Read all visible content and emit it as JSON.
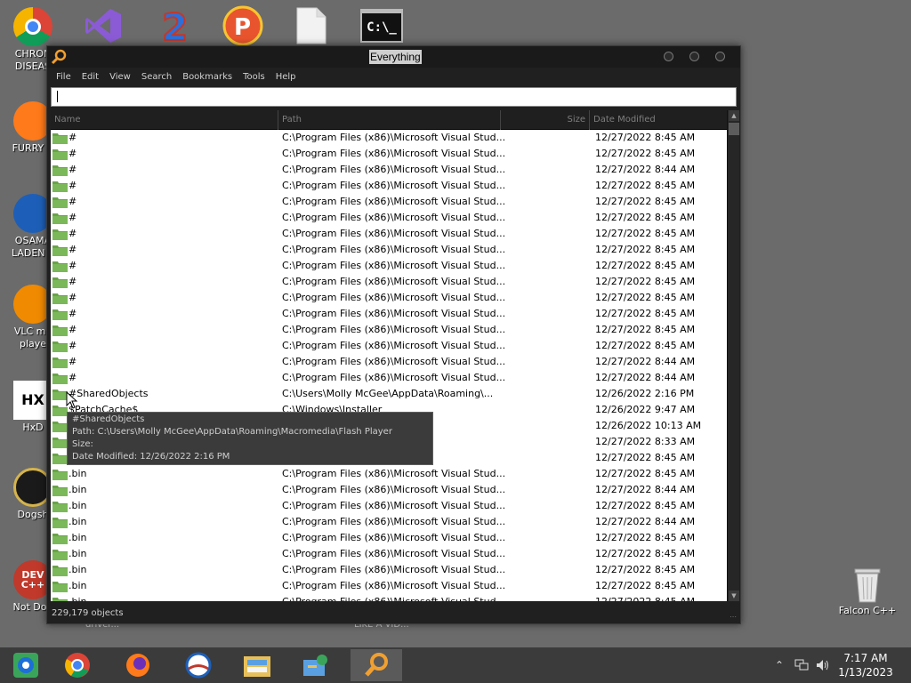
{
  "desktop": {
    "left_icons": [
      {
        "label": "CHRON\nDISEAS",
        "icon": "chrome-icon"
      },
      {
        "label": "FURRY C",
        "icon": "firefox-icon"
      },
      {
        "label": "OSAMA\nLADEN E",
        "icon": "obama-logo-icon"
      },
      {
        "label": "VLC me\nplaye",
        "icon": "vlc-icon"
      },
      {
        "label": "HxD",
        "icon": "hxd-icon"
      },
      {
        "label": "Dogsh",
        "icon": "disc-icon"
      },
      {
        "label": "Not Dog",
        "icon": "devcpp-icon"
      }
    ],
    "left_glyphs": [
      "",
      "",
      "",
      "",
      "HX",
      "",
      "DEV\nC++"
    ],
    "top_icons": [
      {
        "icon": "visual-studio-icon"
      },
      {
        "icon": "number-2-icon"
      },
      {
        "icon": "p-logo-icon"
      },
      {
        "icon": "blank-file-icon"
      },
      {
        "icon": "cmd-icon"
      }
    ],
    "cmd_glyph": "C:\\_",
    "right_icon": {
      "label": "Falcon C++",
      "icon": "recycle-bin-icon"
    },
    "behind_text": [
      "driver...",
      "LIKE A VID..."
    ]
  },
  "window": {
    "title": "Everything",
    "menu": [
      "File",
      "Edit",
      "View",
      "Search",
      "Bookmarks",
      "Tools",
      "Help"
    ],
    "search_value": "",
    "columns": [
      "Name",
      "Path",
      "Size",
      "Date Modified"
    ],
    "rows": [
      {
        "name": "#",
        "path": "C:\\Program Files (x86)\\Microsoft Visual Stud...",
        "size": "",
        "date": "12/27/2022 8:45 AM"
      },
      {
        "name": "#",
        "path": "C:\\Program Files (x86)\\Microsoft Visual Stud...",
        "size": "",
        "date": "12/27/2022 8:45 AM"
      },
      {
        "name": "#",
        "path": "C:\\Program Files (x86)\\Microsoft Visual Stud...",
        "size": "",
        "date": "12/27/2022 8:44 AM"
      },
      {
        "name": "#",
        "path": "C:\\Program Files (x86)\\Microsoft Visual Stud...",
        "size": "",
        "date": "12/27/2022 8:45 AM"
      },
      {
        "name": "#",
        "path": "C:\\Program Files (x86)\\Microsoft Visual Stud...",
        "size": "",
        "date": "12/27/2022 8:45 AM"
      },
      {
        "name": "#",
        "path": "C:\\Program Files (x86)\\Microsoft Visual Stud...",
        "size": "",
        "date": "12/27/2022 8:45 AM"
      },
      {
        "name": "#",
        "path": "C:\\Program Files (x86)\\Microsoft Visual Stud...",
        "size": "",
        "date": "12/27/2022 8:45 AM"
      },
      {
        "name": "#",
        "path": "C:\\Program Files (x86)\\Microsoft Visual Stud...",
        "size": "",
        "date": "12/27/2022 8:45 AM"
      },
      {
        "name": "#",
        "path": "C:\\Program Files (x86)\\Microsoft Visual Stud...",
        "size": "",
        "date": "12/27/2022 8:45 AM"
      },
      {
        "name": "#",
        "path": "C:\\Program Files (x86)\\Microsoft Visual Stud...",
        "size": "",
        "date": "12/27/2022 8:45 AM"
      },
      {
        "name": "#",
        "path": "C:\\Program Files (x86)\\Microsoft Visual Stud...",
        "size": "",
        "date": "12/27/2022 8:45 AM"
      },
      {
        "name": "#",
        "path": "C:\\Program Files (x86)\\Microsoft Visual Stud...",
        "size": "",
        "date": "12/27/2022 8:45 AM"
      },
      {
        "name": "#",
        "path": "C:\\Program Files (x86)\\Microsoft Visual Stud...",
        "size": "",
        "date": "12/27/2022 8:45 AM"
      },
      {
        "name": "#",
        "path": "C:\\Program Files (x86)\\Microsoft Visual Stud...",
        "size": "",
        "date": "12/27/2022 8:45 AM"
      },
      {
        "name": "#",
        "path": "C:\\Program Files (x86)\\Microsoft Visual Stud...",
        "size": "",
        "date": "12/27/2022 8:44 AM"
      },
      {
        "name": "#",
        "path": "C:\\Program Files (x86)\\Microsoft Visual Stud...",
        "size": "",
        "date": "12/27/2022 8:44 AM"
      },
      {
        "name": "#SharedObjects",
        "path": "C:\\Users\\Molly McGee\\AppData\\Roaming\\...",
        "size": "",
        "date": "12/26/2022 2:16 PM"
      },
      {
        "name": "$PatchCache$",
        "path": "C:\\Windows\\Installer",
        "size": "",
        "date": "12/26/2022 9:47 AM"
      },
      {
        "name": "",
        "path": "",
        "size": "",
        "date": "12/26/2022 10:13 AM"
      },
      {
        "name": "",
        "path": "\\Local\\Temp...",
        "size": "",
        "date": "12/27/2022 8:33 AM"
      },
      {
        "name": "",
        "path": "Visual Stud...",
        "size": "",
        "date": "12/27/2022 8:45 AM"
      },
      {
        "name": ".bin",
        "path": "C:\\Program Files (x86)\\Microsoft Visual Stud...",
        "size": "",
        "date": "12/27/2022 8:45 AM"
      },
      {
        "name": ".bin",
        "path": "C:\\Program Files (x86)\\Microsoft Visual Stud...",
        "size": "",
        "date": "12/27/2022 8:44 AM"
      },
      {
        "name": ".bin",
        "path": "C:\\Program Files (x86)\\Microsoft Visual Stud...",
        "size": "",
        "date": "12/27/2022 8:45 AM"
      },
      {
        "name": ".bin",
        "path": "C:\\Program Files (x86)\\Microsoft Visual Stud...",
        "size": "",
        "date": "12/27/2022 8:44 AM"
      },
      {
        "name": ".bin",
        "path": "C:\\Program Files (x86)\\Microsoft Visual Stud...",
        "size": "",
        "date": "12/27/2022 8:45 AM"
      },
      {
        "name": ".bin",
        "path": "C:\\Program Files (x86)\\Microsoft Visual Stud...",
        "size": "",
        "date": "12/27/2022 8:45 AM"
      },
      {
        "name": ".bin",
        "path": "C:\\Program Files (x86)\\Microsoft Visual Stud...",
        "size": "",
        "date": "12/27/2022 8:45 AM"
      },
      {
        "name": ".bin",
        "path": "C:\\Program Files (x86)\\Microsoft Visual Stud...",
        "size": "",
        "date": "12/27/2022 8:45 AM"
      },
      {
        "name": ".bin",
        "path": "C:\\Program Files (x86)\\Microsoft Visual Stud...",
        "size": "",
        "date": "12/27/2022 8:45 AM"
      }
    ],
    "status": "229,179 objects",
    "tooltip": {
      "name": "#SharedObjects",
      "path": "Path: C:\\Users\\Molly McGee\\AppData\\Roaming\\Macromedia\\Flash Player",
      "size": "Size:",
      "date": "Date Modified: 12/26/2022 2:16 PM"
    }
  },
  "taskbar": {
    "apps": [
      "start-icon",
      "chrome-icon",
      "firefox-icon",
      "obama-logo-icon",
      "file-explorer-icon",
      "control-panel-icon",
      "everything-search-icon"
    ],
    "active_index": 6,
    "time": "7:17 AM",
    "date": "1/13/2023"
  },
  "colors": {
    "desktop_bg": "#6b6b6b",
    "window_bg": "#202020",
    "folder": "#6aa24a",
    "tooltip_bg": "#3b3b3b",
    "taskbar_bg": "#3b3b3b"
  }
}
